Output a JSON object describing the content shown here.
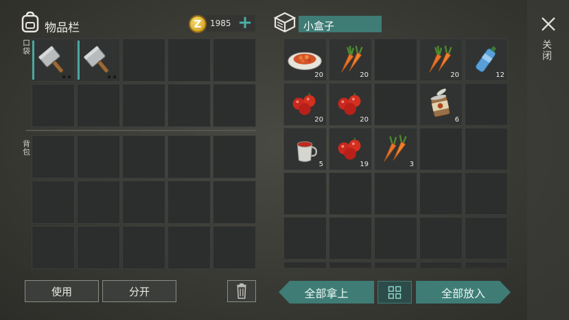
{
  "inventory": {
    "title": "物品栏",
    "pocket_label": "口袋",
    "backpack_label": "背包",
    "coins": "1985",
    "add_coin_symbol": "+",
    "pocket_items": [
      "cleaver",
      "cleaver"
    ]
  },
  "container": {
    "title": "小盒子",
    "items": [
      {
        "icon": "vegetable-dish-icon",
        "qty": "20"
      },
      {
        "icon": "carrot-icon",
        "qty": "20"
      },
      {
        "icon": "",
        "qty": ""
      },
      {
        "icon": "carrot-icon",
        "qty": "20"
      },
      {
        "icon": "water-bottle-icon",
        "qty": "12"
      },
      {
        "icon": "tomato-icon",
        "qty": "20"
      },
      {
        "icon": "tomato-icon",
        "qty": "20"
      },
      {
        "icon": "",
        "qty": ""
      },
      {
        "icon": "canned-food-icon",
        "qty": "6"
      },
      {
        "icon": "",
        "qty": ""
      },
      {
        "icon": "tomato-soup-cup-icon",
        "qty": "5"
      },
      {
        "icon": "tomato-icon",
        "qty": "19"
      },
      {
        "icon": "carrot-icon",
        "qty": "3"
      }
    ]
  },
  "close_label": "关闭",
  "buttons": {
    "use": "使用",
    "split": "分开",
    "take_all": "全部拿上",
    "put_all": "全部放入"
  },
  "colors": {
    "accent": "#3f7c76",
    "accent_light": "#4ab0a6",
    "coin": "#d6a625"
  }
}
